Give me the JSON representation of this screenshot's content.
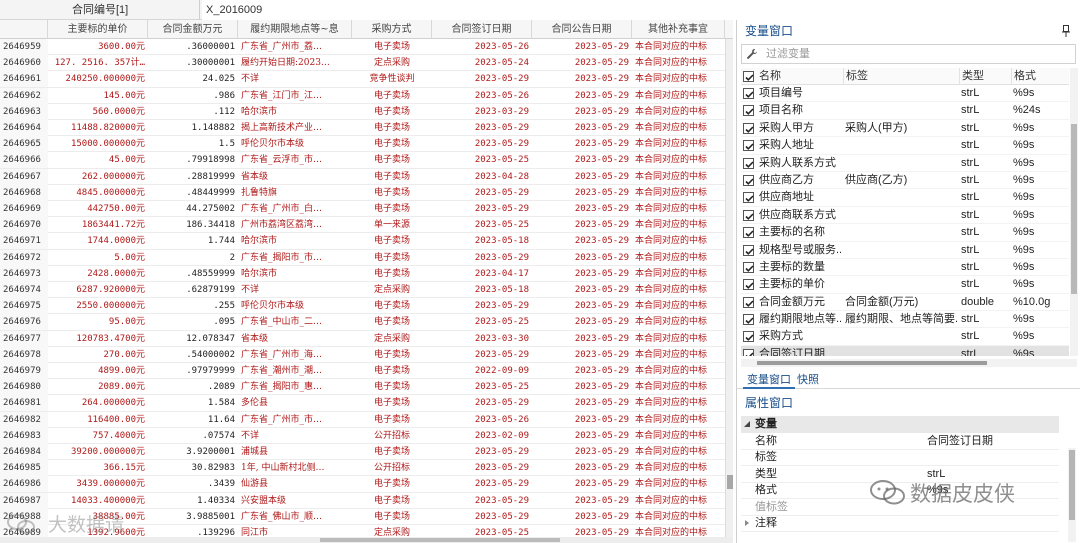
{
  "topbar": {
    "cell_name": "合同编号[1]",
    "cell_value": "X_2016009"
  },
  "grid": {
    "columns": [
      "主要标的单价",
      "合同金额万元",
      "履约期限地点等~息",
      "采购方式",
      "合同签订日期",
      "合同公告日期",
      "其他补充事宜"
    ],
    "rows": [
      [
        "2646959",
        "3600.00元",
        ".36000001",
        "广东省_广州市_荔…",
        "电子卖场",
        "2023-05-26",
        "2023-05-29",
        "本合同对应的中标"
      ],
      [
        "2646960",
        "127. 2516. 357计…",
        ".30000001",
        "履约开始日期:2023…",
        "定点采购",
        "2023-05-24",
        "2023-05-29",
        "本合同对应的中标"
      ],
      [
        "2646961",
        "240250.000000元",
        "24.025",
        "不详",
        "竞争性谈判",
        "2023-05-29",
        "2023-05-29",
        "本合同对应的中标"
      ],
      [
        "2646962",
        "145.00元",
        ".986",
        "广东省_江门市_江…",
        "电子卖场",
        "2023-05-26",
        "2023-05-29",
        "本合同对应的中标"
      ],
      [
        "2646963",
        "560.0000元",
        ".112",
        "哈尔滨市",
        "电子卖场",
        "2023-03-29",
        "2023-05-29",
        "本合同对应的中标"
      ],
      [
        "2646964",
        "11488.820000元",
        "1.148882",
        "揭上高新技术产业…",
        "电子卖场",
        "2023-05-29",
        "2023-05-29",
        "本合同对应的中标"
      ],
      [
        "2646965",
        "15000.000000元",
        "1.5",
        "呼伦贝尔市本级",
        "电子卖场",
        "2023-05-29",
        "2023-05-29",
        "本合同对应的中标"
      ],
      [
        "2646966",
        "45.00元",
        ".79918998",
        "广东省_云浮市_市…",
        "电子卖场",
        "2023-05-25",
        "2023-05-29",
        "本合同对应的中标"
      ],
      [
        "2646967",
        "262.000000元",
        ".28819999",
        "省本级",
        "电子卖场",
        "2023-04-28",
        "2023-05-29",
        "本合同对应的中标"
      ],
      [
        "2646968",
        "4845.000000元",
        ".48449999",
        "扎鲁特旗",
        "电子卖场",
        "2023-05-29",
        "2023-05-29",
        "本合同对应的中标"
      ],
      [
        "2646969",
        "442750.00元",
        "44.275002",
        "广东省_广州市_白…",
        "电子卖场",
        "2023-05-29",
        "2023-05-29",
        "本合同对应的中标"
      ],
      [
        "2646970",
        "1863441.72元",
        "186.34418",
        "广州市荔湾区荔湾…",
        "单一来源",
        "2023-05-25",
        "2023-05-29",
        "本合同对应的中标"
      ],
      [
        "2646971",
        "1744.0000元",
        "1.744",
        "哈尔滨市",
        "电子卖场",
        "2023-05-18",
        "2023-05-29",
        "本合同对应的中标"
      ],
      [
        "2646972",
        "5.00元",
        "2",
        "广东省_揭阳市_市…",
        "电子卖场",
        "2023-05-29",
        "2023-05-29",
        "本合同对应的中标"
      ],
      [
        "2646973",
        "2428.0000元",
        ".48559999",
        "哈尔滨市",
        "电子卖场",
        "2023-04-17",
        "2023-05-29",
        "本合同对应的中标"
      ],
      [
        "2646974",
        "6287.920000元",
        ".62879199",
        "不详",
        "定点采购",
        "2023-05-18",
        "2023-05-29",
        "本合同对应的中标"
      ],
      [
        "2646975",
        "2550.000000元",
        ".255",
        "呼伦贝尔市本级",
        "电子卖场",
        "2023-05-29",
        "2023-05-29",
        "本合同对应的中标"
      ],
      [
        "2646976",
        "95.00元",
        ".095",
        "广东省_中山市_二…",
        "电子卖场",
        "2023-05-25",
        "2023-05-29",
        "本合同对应的中标"
      ],
      [
        "2646977",
        "120783.4700元",
        "12.078347",
        "省本级",
        "定点采购",
        "2023-03-30",
        "2023-05-29",
        "本合同对应的中标"
      ],
      [
        "2646978",
        "270.00元",
        ".54000002",
        "广东省_广州市_海…",
        "电子卖场",
        "2023-05-29",
        "2023-05-29",
        "本合同对应的中标"
      ],
      [
        "2646979",
        "4899.00元",
        ".97979999",
        "广东省_潮州市_潮…",
        "电子卖场",
        "2022-09-09",
        "2023-05-29",
        "本合同对应的中标"
      ],
      [
        "2646980",
        "2089.00元",
        ".2089",
        "广东省_揭阳市_惠…",
        "电子卖场",
        "2023-05-25",
        "2023-05-29",
        "本合同对应的中标"
      ],
      [
        "2646981",
        "264.000000元",
        "1.584",
        "多伦县",
        "电子卖场",
        "2023-05-29",
        "2023-05-29",
        "本合同对应的中标"
      ],
      [
        "2646982",
        "116400.00元",
        "11.64",
        "广东省_广州市_市…",
        "电子卖场",
        "2023-05-26",
        "2023-05-29",
        "本合同对应的中标"
      ],
      [
        "2646983",
        "757.4000元",
        ".07574",
        "不详",
        "公开招标",
        "2023-02-09",
        "2023-05-29",
        "本合同对应的中标"
      ],
      [
        "2646984",
        "39200.000000元",
        "3.9200001",
        "浦城县",
        "电子卖场",
        "2023-05-29",
        "2023-05-29",
        "本合同对应的中标"
      ],
      [
        "2646985",
        "366.15元",
        "30.82983",
        "1年, 中山新村北侧…",
        "公开招标",
        "2023-05-29",
        "2023-05-29",
        "本合同对应的中标"
      ],
      [
        "2646986",
        "3439.000000元",
        ".3439",
        "仙游县",
        "电子卖场",
        "2023-05-29",
        "2023-05-29",
        "本合同对应的中标"
      ],
      [
        "2646987",
        "14033.400000元",
        "1.40334",
        "兴安盟本级",
        "电子卖场",
        "2023-05-29",
        "2023-05-29",
        "本合同对应的中标"
      ],
      [
        "2646988",
        "38885.00元",
        "3.9885001",
        "广东省_佛山市_顺…",
        "电子卖场",
        "2023-05-29",
        "2023-05-29",
        "本合同对应的中标"
      ],
      [
        "2646989",
        "1392.9600元",
        ".139296",
        "同江市",
        "定点采购",
        "2023-05-25",
        "2023-05-29",
        "本合同对应的中标"
      ]
    ]
  },
  "variables_window": {
    "title": "变量窗口",
    "filter_placeholder": "过滤变量",
    "headers": {
      "name": "名称",
      "label": "标签",
      "type": "类型",
      "format": "格式"
    },
    "items": [
      {
        "name": "项目编号",
        "label": "",
        "type": "strL",
        "format": "%9s"
      },
      {
        "name": "项目名称",
        "label": "",
        "type": "strL",
        "format": "%24s"
      },
      {
        "name": "采购人甲方",
        "label": "采购人(甲方)",
        "type": "strL",
        "format": "%9s"
      },
      {
        "name": "采购人地址",
        "label": "",
        "type": "strL",
        "format": "%9s"
      },
      {
        "name": "采购人联系方式",
        "label": "",
        "type": "strL",
        "format": "%9s"
      },
      {
        "name": "供应商乙方",
        "label": "供应商(乙方)",
        "type": "strL",
        "format": "%9s"
      },
      {
        "name": "供应商地址",
        "label": "",
        "type": "strL",
        "format": "%9s"
      },
      {
        "name": "供应商联系方式",
        "label": "",
        "type": "strL",
        "format": "%9s"
      },
      {
        "name": "主要标的名称",
        "label": "",
        "type": "strL",
        "format": "%9s"
      },
      {
        "name": "规格型号或服务...",
        "label": "",
        "type": "strL",
        "format": "%9s"
      },
      {
        "name": "主要标的数量",
        "label": "",
        "type": "strL",
        "format": "%9s"
      },
      {
        "name": "主要标的单价",
        "label": "",
        "type": "strL",
        "format": "%9s"
      },
      {
        "name": "合同金额万元",
        "label": "合同金额(万元)",
        "type": "double",
        "format": "%10.0g"
      },
      {
        "name": "履约期限地点等...",
        "label": "履约期限、地点等简要...",
        "type": "strL",
        "format": "%9s"
      },
      {
        "name": "采购方式",
        "label": "",
        "type": "strL",
        "format": "%9s"
      },
      {
        "name": "合同签订日期",
        "label": "",
        "type": "strL",
        "format": "%9s"
      }
    ]
  },
  "tabs": [
    "变量窗口",
    "快照"
  ],
  "properties_window": {
    "title": "属性窗口",
    "group_variable": "变量",
    "rows": [
      {
        "key": "名称",
        "value": "合同签订日期"
      },
      {
        "key": "标签",
        "value": ""
      },
      {
        "key": "类型",
        "value": "strL"
      },
      {
        "key": "格式",
        "value": "%9s"
      },
      {
        "key": "值标签",
        "value": ""
      },
      {
        "key": "注释",
        "value": ""
      }
    ],
    "group_data": "数据"
  },
  "watermarks": {
    "right": "数据皮皮侠",
    "left": "大数据请"
  },
  "colors": {
    "accent": "#1a4f8a",
    "data_red": "#b01818"
  }
}
